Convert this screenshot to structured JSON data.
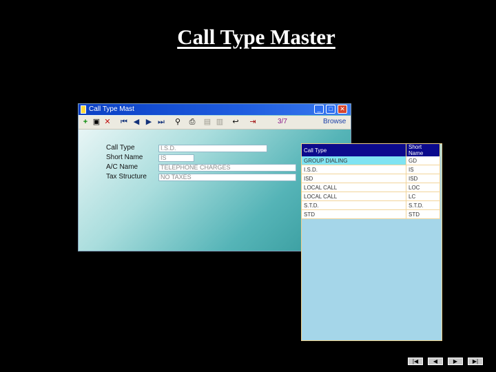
{
  "slide": {
    "title": "Call Type Master"
  },
  "window": {
    "title": "Call Type Mast",
    "buttons": {
      "minimize": "_",
      "maximize": "□",
      "close": "✕"
    },
    "record_count": "3/7",
    "mode": "Browse"
  },
  "toolbar": {
    "icons": [
      "add-icon",
      "save-icon",
      "delete-icon",
      "first-record-icon",
      "previous-record-icon",
      "next-record-icon",
      "last-record-icon",
      "find-icon",
      "print-icon",
      "save-disk-icon",
      "save-all-icon",
      "undo-icon",
      "exit-icon"
    ],
    "glyphs": {
      "add": "+",
      "save": "▣",
      "delete": "✕",
      "first": "⏮",
      "prev": "◀",
      "next": "▶",
      "last": "⏭",
      "find": "⚲",
      "print": "⎙",
      "disk": "▤",
      "disk2": "▥",
      "undo": "↩",
      "exit": "⇥"
    }
  },
  "form": {
    "call_type_label": "Call Type",
    "call_type_value": "I.S.D.",
    "short_name_label": "Short Name",
    "short_name_value": "IS",
    "ac_name_label": "A/C Name",
    "ac_name_value": "TELEPHONE CHARGES",
    "tax_structure_label": "Tax Structure",
    "tax_structure_value": "NO TAXES"
  },
  "browse": {
    "headers": [
      "Call Type",
      "Short Name"
    ],
    "rows": [
      [
        "GROUP DIALING",
        "GD"
      ],
      [
        "I.S.D.",
        "IS"
      ],
      [
        "ISD",
        "ISD"
      ],
      [
        "LOCAL CALL",
        "LOC"
      ],
      [
        "LOCAL CALL",
        "LC"
      ],
      [
        "S.T.D.",
        "S.T.D."
      ],
      [
        "STD",
        "STD"
      ]
    ],
    "selected_row": 0
  },
  "slide_nav": {
    "first": "|◀",
    "prev": "◀",
    "next": "▶",
    "last": "▶|"
  },
  "colors": {
    "titlebar": "#0a3fc4",
    "header": "#0c0a8c",
    "list_bg": "#a5d6e9"
  }
}
